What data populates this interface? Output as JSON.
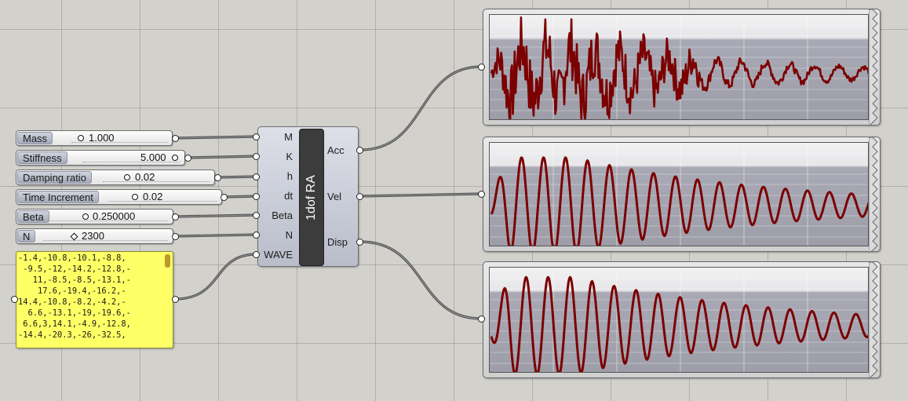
{
  "sliders": [
    {
      "label": "Mass",
      "value": "1.000",
      "handle": "circle"
    },
    {
      "label": "Stiffness",
      "value": "5.000",
      "handle": "circle"
    },
    {
      "label": "Damping ratio",
      "value": "0.02",
      "handle": "circle"
    },
    {
      "label": "Time Increment",
      "value": "0.02",
      "handle": "circle"
    },
    {
      "label": "Beta",
      "value": "0.250000",
      "handle": "circle"
    },
    {
      "label": "N",
      "value": "2300",
      "handle": "diamond"
    }
  ],
  "panel": {
    "text": "-1.4,-10.8,-10.1,-8.8,\n -9.5,-12,-14.2,-12.8,-\n   11,-8.5,-8.5,-13.1,-\n    17.6,-19.4,-16.2,-\n14.4,-10.8,-8.2,-4.2,-\n  6.6,-13.1,-19,-19.6,-\n 6.6,3,14.1,-4.9,-12.8,\n-14.4,-20.3,-26,-32.5,"
  },
  "component": {
    "name": "1dof RA",
    "inputs": [
      "M",
      "K",
      "h",
      "dt",
      "Beta",
      "N",
      "WAVE"
    ],
    "outputs": [
      "Acc",
      "Vel",
      "Disp"
    ]
  },
  "colors": {
    "canvas": "#d3d1cc",
    "trace": "#7b0000",
    "panel": "#ffff66",
    "wire": "#505050"
  },
  "scopes": [
    {
      "name": "acc-scope",
      "source": "Acc",
      "signal": "acceleration"
    },
    {
      "name": "vel-scope",
      "source": "Vel",
      "signal": "velocity"
    },
    {
      "name": "disp-scope",
      "source": "Disp",
      "signal": "displacement"
    }
  ]
}
